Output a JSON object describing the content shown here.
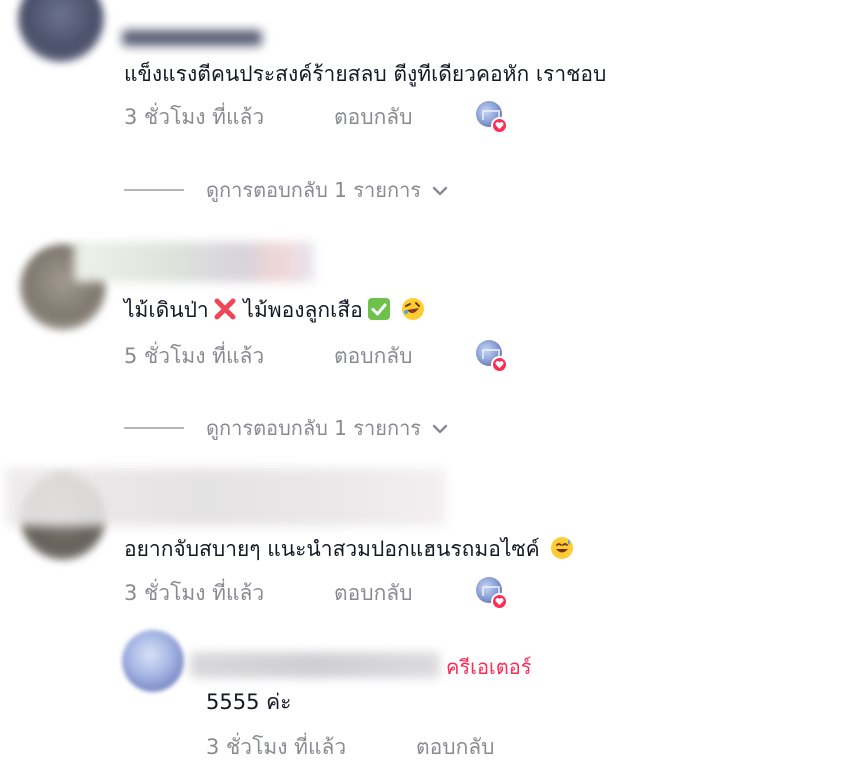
{
  "comments": [
    {
      "text": "แข็งแรงตีคนประสงค์ร้ายสลบ ตีงูทีเดียวคอหัก เราชอบ",
      "time": "3 ชั่วโมง ที่แล้ว",
      "reply_label": "ตอบกลับ",
      "view_replies": "ดูการตอบกลับ 1 รายการ"
    },
    {
      "text": "ไม้เดินป่า",
      "text_mid": " ไม้พองลูกเสือ",
      "emojis": [
        "cross-mark-emoji",
        "check-mark-button-emoji",
        "rolling-laughing-emoji"
      ],
      "time": "5 ชั่วโมง ที่แล้ว",
      "reply_label": "ตอบกลับ",
      "view_replies": "ดูการตอบกลับ 1 รายการ"
    },
    {
      "text": "อยากจับสบายๆ แนะนำสวมปอกแฮนรถมอไซค์",
      "emojis": [
        "grinning-sweat-emoji"
      ],
      "time": "3 ชั่วโมง ที่แล้ว",
      "reply_label": "ตอบกลับ"
    }
  ],
  "creator_reply": {
    "badge": "ครีเอเตอร์",
    "text": "5555 ค่ะ",
    "time": "3 ชั่วโมง ที่แล้ว",
    "reply_label": "ตอบกลับ"
  },
  "colors": {
    "text": "#161823",
    "muted": "#8a8b91",
    "accent": "#fe2c55"
  },
  "icons": [
    "chevron-down-icon",
    "heart-icon"
  ]
}
